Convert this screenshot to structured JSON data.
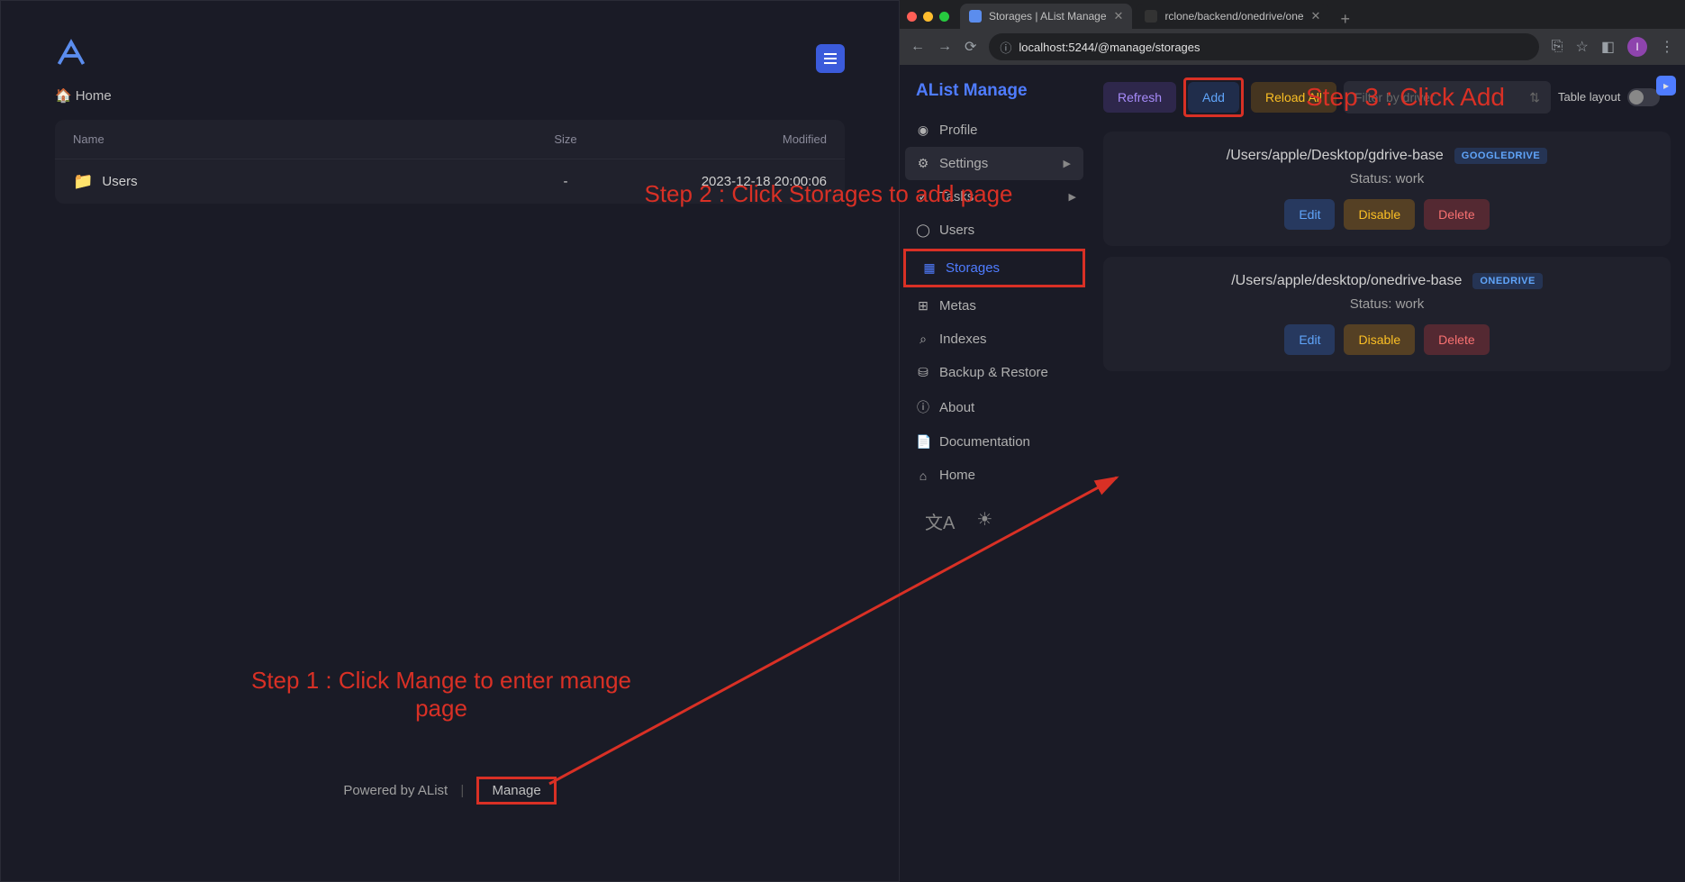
{
  "left": {
    "breadcrumb_home": "Home",
    "columns": {
      "name": "Name",
      "size": "Size",
      "modified": "Modified"
    },
    "rows": [
      {
        "name": "Users",
        "size": "-",
        "modified": "2023-12-18 20:00:06"
      }
    ],
    "footer_powered": "Powered by AList",
    "footer_manage": "Manage"
  },
  "browser": {
    "tabs": [
      {
        "title": "Storages | AList Manage",
        "active": true
      },
      {
        "title": "rclone/backend/onedrive/one",
        "active": false
      }
    ],
    "url": "localhost:5244/@manage/storages"
  },
  "manage": {
    "title": "AList Manage",
    "nav": {
      "profile": "Profile",
      "settings": "Settings",
      "tasks": "Tasks",
      "users": "Users",
      "storages": "Storages",
      "metas": "Metas",
      "indexes": "Indexes",
      "backup": "Backup & Restore",
      "about": "About",
      "documentation": "Documentation",
      "home": "Home"
    },
    "toolbar": {
      "refresh": "Refresh",
      "add": "Add",
      "reload": "Reload All",
      "filter_placeholder": "Filter by driver",
      "table_layout": "Table layout"
    },
    "storages": [
      {
        "path": "/Users/apple/Desktop/gdrive-base",
        "badge": "GOOGLEDRIVE",
        "status": "Status: work"
      },
      {
        "path": "/Users/apple/desktop/onedrive-base",
        "badge": "ONEDRIVE",
        "status": "Status: work"
      }
    ],
    "actions": {
      "edit": "Edit",
      "disable": "Disable",
      "delete": "Delete"
    }
  },
  "annotations": {
    "step1": "Step 1 : Click Mange to enter mange page",
    "step2": "Step 2 : Click Storages to add page",
    "step3": "Step 3 : Click Add"
  }
}
